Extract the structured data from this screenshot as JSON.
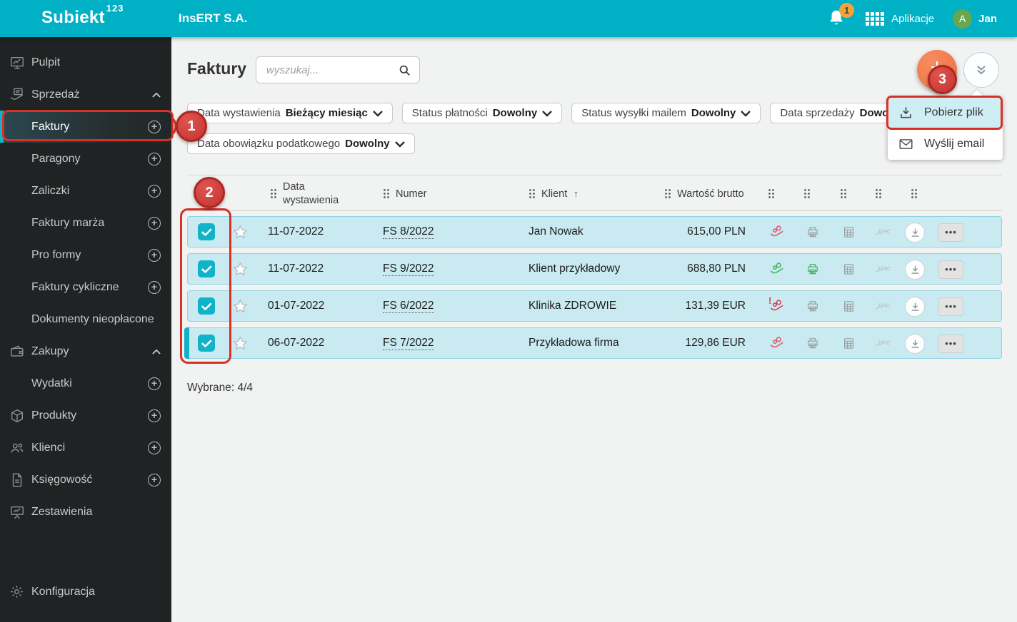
{
  "topbar": {
    "logo": "Subiekt",
    "logo_sup": "123",
    "company": "InsERT S.A.",
    "notification_count": "1",
    "apps_label": "Aplikacje",
    "avatar_initial": "A",
    "user_name": "Jan"
  },
  "sidebar": {
    "items": [
      {
        "label": "Pulpit"
      },
      {
        "label": "Sprzedaż"
      },
      {
        "label": "Faktury"
      },
      {
        "label": "Paragony"
      },
      {
        "label": "Zaliczki"
      },
      {
        "label": "Faktury marża"
      },
      {
        "label": "Pro formy"
      },
      {
        "label": "Faktury cykliczne"
      },
      {
        "label": "Dokumenty nieopłacone"
      },
      {
        "label": "Zakupy"
      },
      {
        "label": "Wydatki"
      },
      {
        "label": "Produkty"
      },
      {
        "label": "Klienci"
      },
      {
        "label": "Księgowość"
      },
      {
        "label": "Zestawienia"
      },
      {
        "label": "Konfiguracja"
      }
    ]
  },
  "page": {
    "title": "Faktury",
    "search_placeholder": "wyszukaj...",
    "selected_summary": "Wybrane: 4/4"
  },
  "filters": [
    {
      "label": "Data wystawienia",
      "value": "Bieżący miesiąc"
    },
    {
      "label": "Status płatności",
      "value": "Dowolny"
    },
    {
      "label": "Status wysyłki mailem",
      "value": "Dowolny"
    },
    {
      "label": "Data sprzedaży",
      "value": "Dowolny"
    },
    {
      "label": "Data obowiązku podatkowego",
      "value": "Dowolny"
    }
  ],
  "table": {
    "headers": {
      "date": "Data wystawienia",
      "number": "Numer",
      "client": "Klient",
      "client_sort": "↑",
      "value": "Wartość brutto"
    },
    "rows": [
      {
        "date": "11-07-2022",
        "number": "FS 8/2022",
        "client": "Jan Nowak",
        "amount": "615,00 PLN",
        "payment_status": "st-red",
        "print_status": "st-gray"
      },
      {
        "date": "11-07-2022",
        "number": "FS 9/2022",
        "client": "Klient przykładowy",
        "amount": "688,80 PLN",
        "payment_status": "st-green",
        "print_status": "st-green"
      },
      {
        "date": "01-07-2022",
        "number": "FS 6/2022",
        "client": "Klinika ZDROWIE",
        "amount": "131,39 EUR",
        "payment_status": "st-red-alert",
        "print_status": "st-gray"
      },
      {
        "date": "06-07-2022",
        "number": "FS 7/2022",
        "client": "Przykładowa firma",
        "amount": "129,86 EUR",
        "payment_status": "st-red",
        "print_status": "st-gray"
      }
    ]
  },
  "menu": {
    "items": [
      {
        "label": "Pobierz plik"
      },
      {
        "label": "Wyślij email"
      }
    ]
  },
  "annotations": {
    "step1": "1",
    "step2": "2",
    "step3": "3"
  },
  "colors": {
    "topbar": "#00b1c5",
    "sidebar": "#1f2323",
    "row_highlight": "#c9eaf1",
    "checkbox": "#10b3c9",
    "fab": "#ef6f42",
    "annotation": "#d93025",
    "paid": "#43b45c",
    "unpaid": "#e0556a",
    "badge": "#f2a43a",
    "avatar": "#69a74e"
  }
}
